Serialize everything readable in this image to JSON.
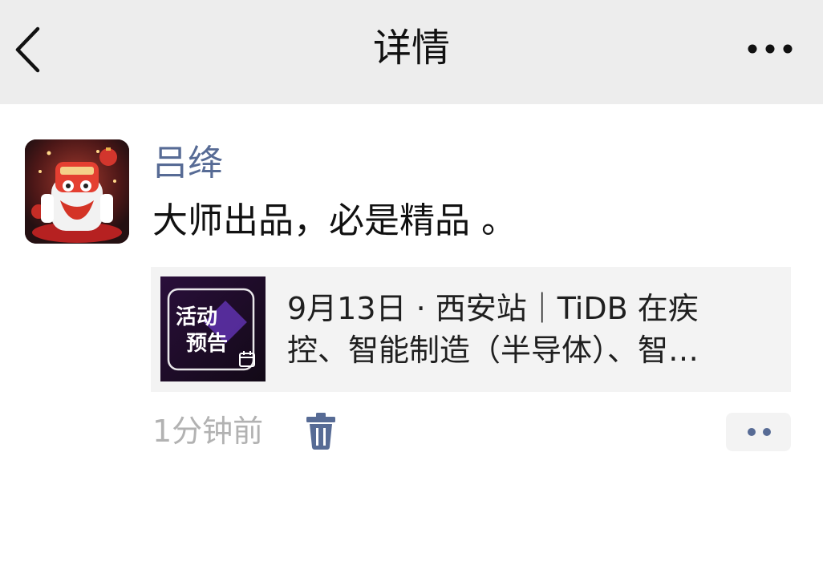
{
  "header": {
    "title": "详情",
    "back_icon": "chevron-left-icon",
    "more_icon": "more-horizontal-icon"
  },
  "post": {
    "author": "吕绛",
    "text": "大师出品，必是精品 。",
    "time": "1分钟前",
    "delete_icon": "trash-icon",
    "action_icon": "more-dots-icon"
  },
  "share_card": {
    "thumb_line1": "活动",
    "thumb_line2": "预告",
    "title_line1": "9月13日 · 西安站｜TiDB 在疾",
    "title_line2": "控、智能制造（半导体）、智…"
  },
  "colors": {
    "nav_bg": "#ededed",
    "author_link": "#576b95",
    "time_gray": "#b2b2b2",
    "card_bg": "#f3f3f3"
  }
}
